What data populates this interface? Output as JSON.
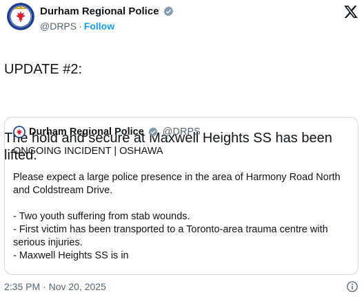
{
  "author": {
    "name": "Durham Regional Police",
    "handle": "@DRPS",
    "separator": "·",
    "follow_label": "Follow",
    "avatar_icon": "police-crest-icon",
    "verified_icon": "verified-badge-icon",
    "colors": {
      "verified": "#829aab",
      "follow": "#1d9bf0",
      "crest_blue": "#1e3f8f",
      "crest_red": "#d3202b"
    }
  },
  "post": {
    "line1": "UPDATE #2:",
    "line2": "The hold and secure at Maxwell Heights SS has been lifted."
  },
  "quote": {
    "name": "Durham Regional Police",
    "handle": "@DRPS",
    "p1": "ONGOING INCIDENT | OSHAWA",
    "p2": "Please expect a large police presence in the area of Harmony Road North and Coldstream Drive.",
    "p3": "- Two youth suffering from stab wounds.",
    "p4": "- First victim has been transported to a Toronto-area trauma centre with serious injuries.",
    "p5": "- Maxwell Heights SS is in"
  },
  "footer": {
    "timestamp": "2:35 PM · Nov 20, 2025",
    "info_icon": "info-icon"
  },
  "platform_icon": "x-logo-icon"
}
